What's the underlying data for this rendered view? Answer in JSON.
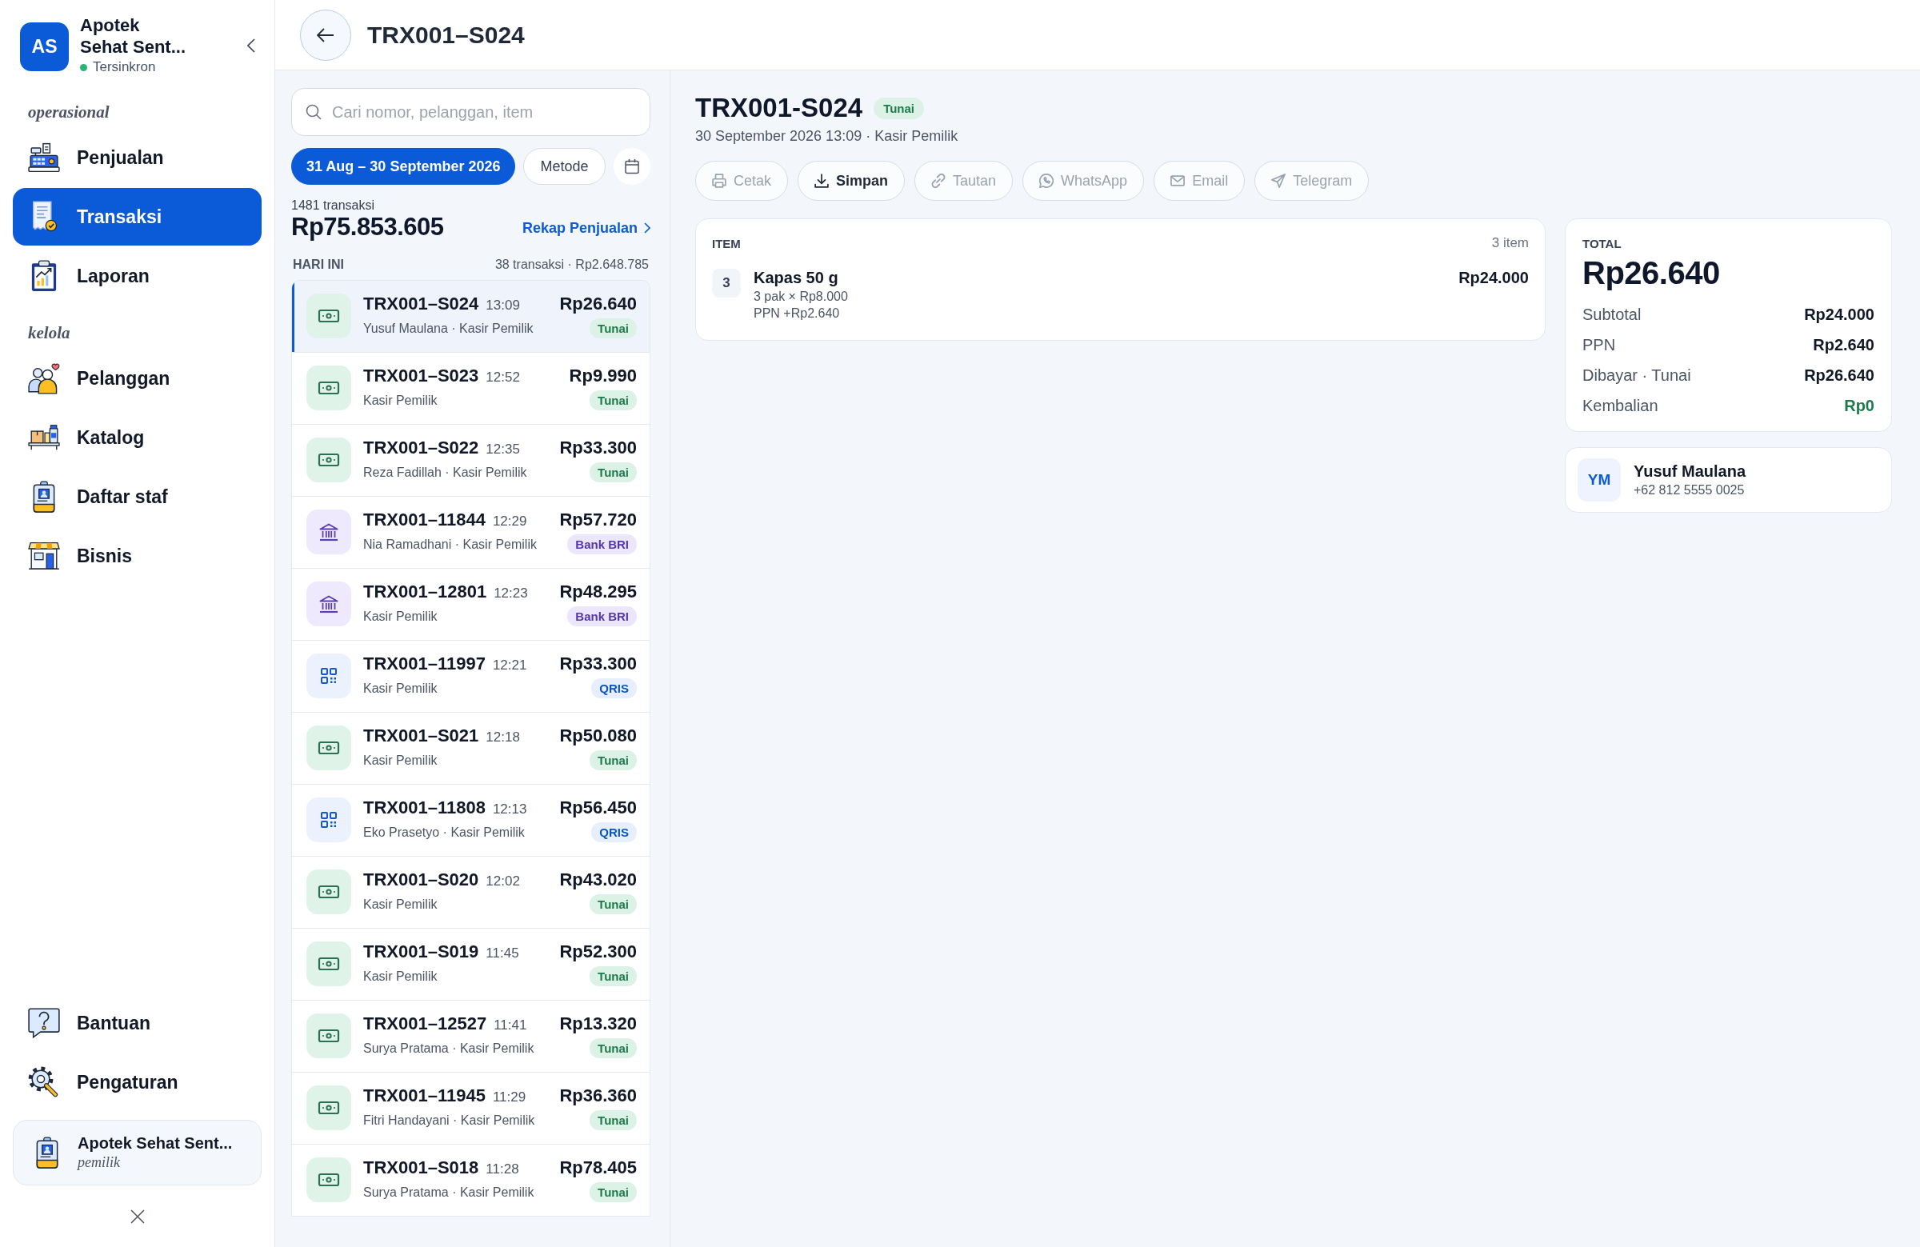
{
  "sidebar": {
    "logo": "AS",
    "app_name": "Apotek Sehat Sent...",
    "sync_status": {
      "label": "Tersinkron",
      "synced": true
    },
    "sections": [
      {
        "label": "operasional",
        "items": [
          {
            "label": "Penjualan",
            "selected": false
          },
          {
            "label": "Transaksi",
            "selected": true
          },
          {
            "label": "Laporan",
            "selected": false
          }
        ]
      },
      {
        "label": "kelola",
        "items": [
          {
            "label": "Pelanggan",
            "selected": false
          },
          {
            "label": "Katalog",
            "selected": false
          },
          {
            "label": "Daftar staf",
            "selected": false
          },
          {
            "label": "Bisnis",
            "selected": false
          }
        ]
      }
    ],
    "footer_items": [
      {
        "label": "Bantuan",
        "selected": false
      },
      {
        "label": "Pengaturan",
        "selected": false
      }
    ],
    "account": {
      "name": "Apotek Sehat Sent...",
      "role": "pemilik"
    }
  },
  "header": {
    "title": "TRX001–S024"
  },
  "transactions": {
    "search": {
      "placeholder": "Cari nomor, pelanggan, item"
    },
    "filters": [
      {
        "label": "31 Aug – 30 September 2026",
        "selected": true
      },
      {
        "label": "Metode",
        "selected": false
      }
    ],
    "count": "1481 transaksi",
    "total": "Rp75.853.605",
    "recap_link": "Rekap Penjualan",
    "group": {
      "label": "HARI INI",
      "summary": "38 transaksi · Rp2.648.785"
    },
    "rows": [
      {
        "id": "TRX001–S024",
        "time": "13:09",
        "meta": "Yusuf Maulana · Kasir Pemilik",
        "amount": "Rp26.640",
        "method": "Tunai",
        "kind": "cash",
        "selected": true
      },
      {
        "id": "TRX001–S023",
        "time": "12:52",
        "meta": "Kasir Pemilik",
        "amount": "Rp9.990",
        "method": "Tunai",
        "kind": "cash",
        "selected": false
      },
      {
        "id": "TRX001–S022",
        "time": "12:35",
        "meta": "Reza Fadillah · Kasir Pemilik",
        "amount": "Rp33.300",
        "method": "Tunai",
        "kind": "cash",
        "selected": false
      },
      {
        "id": "TRX001–11844",
        "time": "12:29",
        "meta": "Nia Ramadhani · Kasir Pemilik",
        "amount": "Rp57.720",
        "method": "Bank BRI",
        "kind": "bank",
        "selected": false
      },
      {
        "id": "TRX001–12801",
        "time": "12:23",
        "meta": "Kasir Pemilik",
        "amount": "Rp48.295",
        "method": "Bank BRI",
        "kind": "bank",
        "selected": false
      },
      {
        "id": "TRX001–11997",
        "time": "12:21",
        "meta": "Kasir Pemilik",
        "amount": "Rp33.300",
        "method": "QRIS",
        "kind": "qris",
        "selected": false
      },
      {
        "id": "TRX001–S021",
        "time": "12:18",
        "meta": "Kasir Pemilik",
        "amount": "Rp50.080",
        "method": "Tunai",
        "kind": "cash",
        "selected": false
      },
      {
        "id": "TRX001–11808",
        "time": "12:13",
        "meta": "Eko Prasetyo · Kasir Pemilik",
        "amount": "Rp56.450",
        "method": "QRIS",
        "kind": "qris",
        "selected": false
      },
      {
        "id": "TRX001–S020",
        "time": "12:02",
        "meta": "Kasir Pemilik",
        "amount": "Rp43.020",
        "method": "Tunai",
        "kind": "cash",
        "selected": false
      },
      {
        "id": "TRX001–S019",
        "time": "11:45",
        "meta": "Kasir Pemilik",
        "amount": "Rp52.300",
        "method": "Tunai",
        "kind": "cash",
        "selected": false
      },
      {
        "id": "TRX001–12527",
        "time": "11:41",
        "meta": "Surya Pratama · Kasir Pemilik",
        "amount": "Rp13.320",
        "method": "Tunai",
        "kind": "cash",
        "selected": false
      },
      {
        "id": "TRX001–11945",
        "time": "11:29",
        "meta": "Fitri Handayani · Kasir Pemilik",
        "amount": "Rp36.360",
        "method": "Tunai",
        "kind": "cash",
        "selected": false
      },
      {
        "id": "TRX001–S018",
        "time": "11:28",
        "meta": "Surya Pratama · Kasir Pemilik",
        "amount": "Rp78.405",
        "method": "Tunai",
        "kind": "cash",
        "selected": false
      }
    ]
  },
  "detail": {
    "title": "TRX001-S024",
    "badge": {
      "label": "Tunai",
      "kind": "cash"
    },
    "meta": "30 September 2026 13:09 · Kasir Pemilik",
    "actions": [
      {
        "label": "Cetak",
        "disabled": true
      },
      {
        "label": "Simpan",
        "disabled": false
      },
      {
        "label": "Tautan",
        "disabled": true
      },
      {
        "label": "WhatsApp",
        "disabled": true
      },
      {
        "label": "Email",
        "disabled": true
      },
      {
        "label": "Telegram",
        "disabled": true
      }
    ],
    "items_card": {
      "heading": "ITEM",
      "count": "3 item",
      "items": [
        {
          "qty": "3",
          "name": "Kapas 50 g",
          "detail": "3 pak × Rp8.000",
          "tax": "PPN +Rp2.640",
          "amount": "Rp24.000"
        }
      ]
    },
    "total_card": {
      "heading": "TOTAL",
      "amount": "Rp26.640",
      "rows": [
        {
          "label": "Subtotal",
          "value": "Rp24.000",
          "color": "#111827"
        },
        {
          "label": "PPN",
          "value": "Rp2.640",
          "color": "#111827"
        },
        {
          "label": "Dibayar · Tunai",
          "value": "Rp26.640",
          "color": "#111827"
        },
        {
          "label": "Kembalian",
          "value": "Rp0",
          "color": "#1e7a4c"
        }
      ]
    },
    "customer": {
      "initials": "YM",
      "name": "Yusuf Maulana",
      "phone": "+62 812 5555 0025"
    }
  }
}
